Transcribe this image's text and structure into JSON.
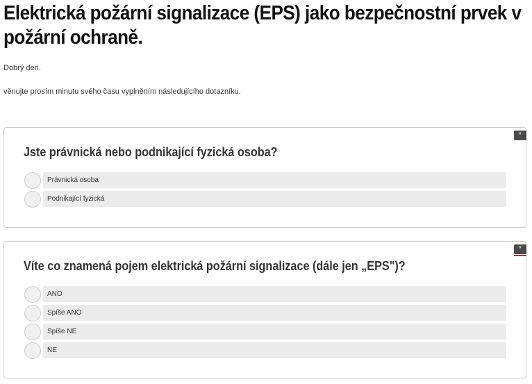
{
  "page": {
    "title": "Elektrická požární signalizace (EPS) jako bezpečnostní prvek v požární ochraně.",
    "greeting": "Dobrý den.",
    "request": "věnujte prosím minutu svého času vyplněním následujícího dotazníku."
  },
  "required_marker": "*",
  "questions": [
    {
      "title": "Jste právnická nebo podnikající fyzická osoba?",
      "options": [
        {
          "label": "Právnická osoba"
        },
        {
          "label": "Podnikající fyzická"
        }
      ]
    },
    {
      "title": "Víte co znamená pojem elektrická požární signalizace (dále jen „EPS\")?",
      "options": [
        {
          "label": "ANO"
        },
        {
          "label": "Spíše ANO"
        },
        {
          "label": "Spíše NE"
        },
        {
          "label": "NE"
        }
      ]
    }
  ],
  "colors": {
    "card_border": "#c9c9c9",
    "option_background": "#ebebeb",
    "radio_background": "#f0f0f0",
    "required_badge": "#4a4a4a"
  }
}
